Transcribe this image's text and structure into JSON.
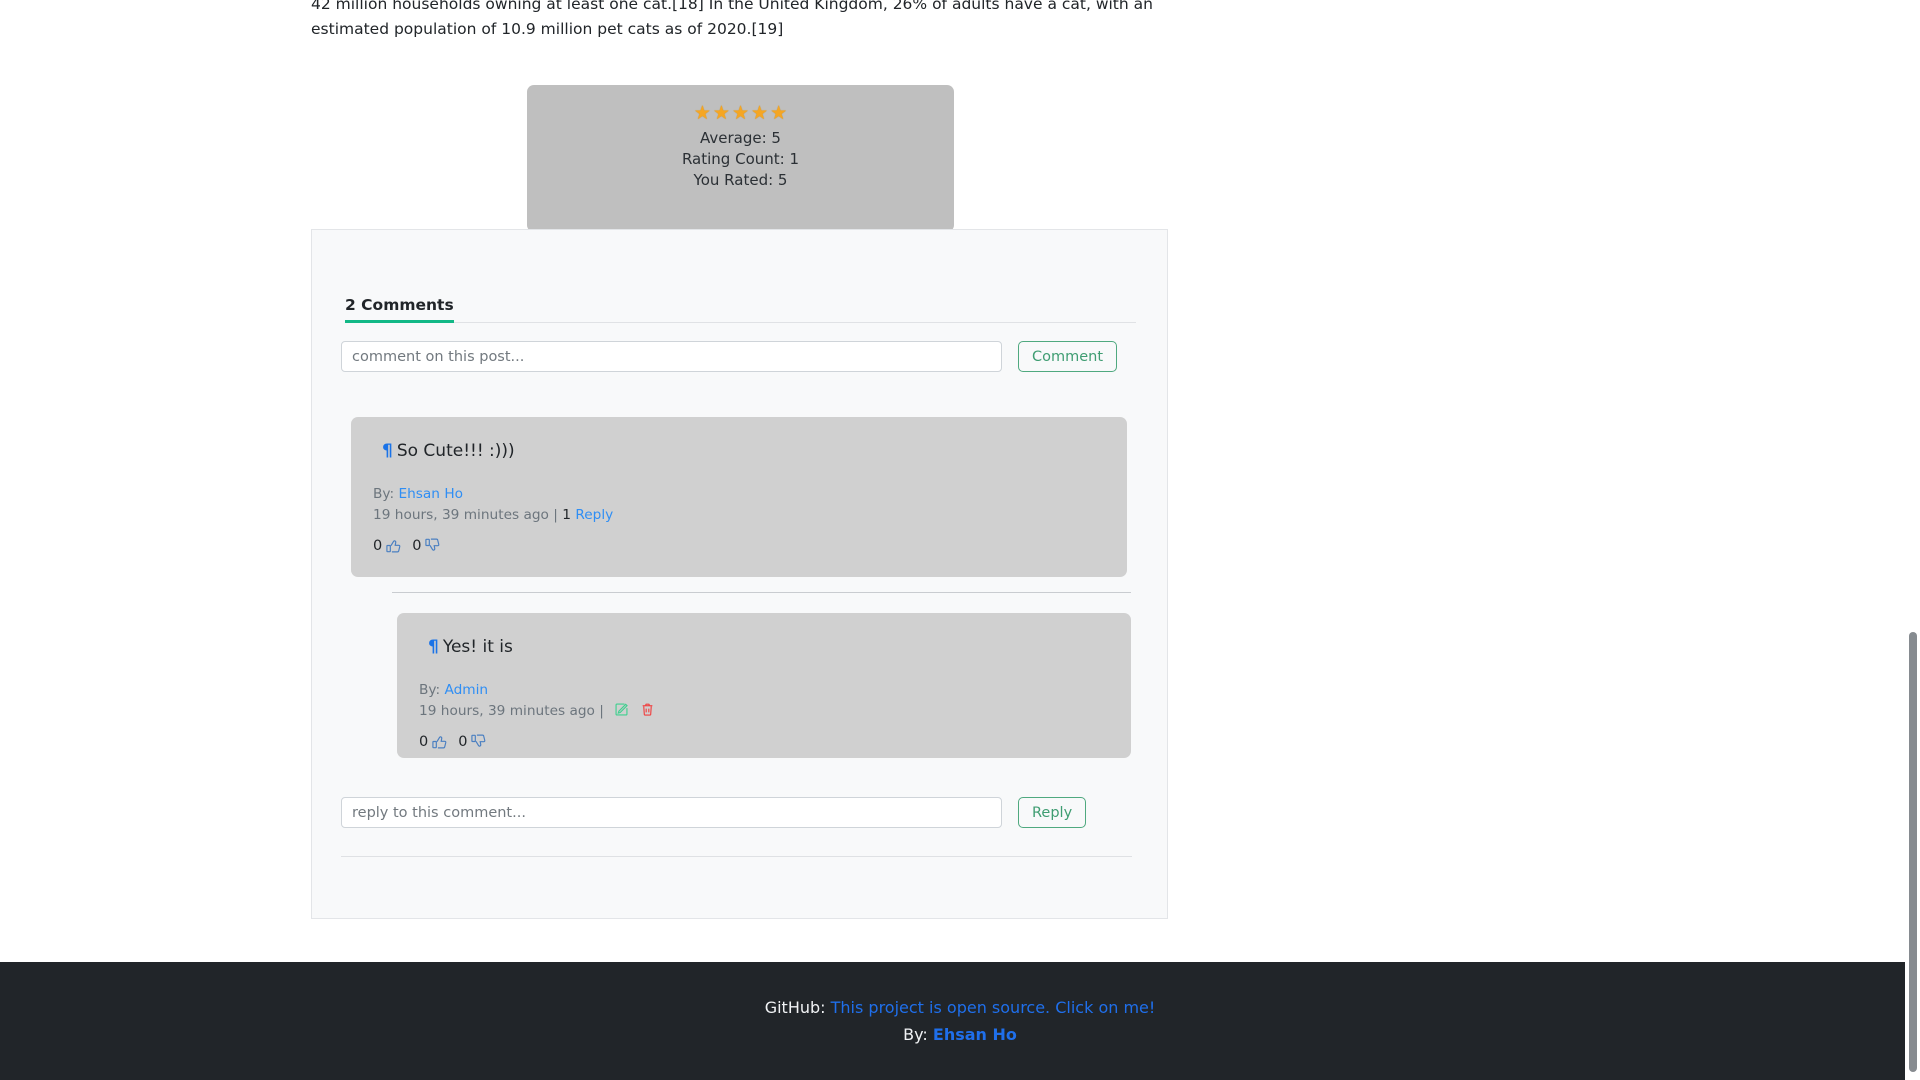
{
  "article": {
    "paragraph": "42 million households owning at least one cat.[18] In the United Kingdom, 26% of adults have a cat, with an estimated population of 10.9 million pet cats as of 2020.[19]"
  },
  "rating": {
    "stars_filled": 5,
    "star_glyph": "★",
    "average_label": "Average: 5",
    "count_label": "Rating Count: 1",
    "you_rated_label": "You Rated: 5",
    "star_color": "#f5a623",
    "box_color": "#bfbfbf"
  },
  "comments_section": {
    "header": "2 Comments",
    "accent_color": "#12b886",
    "new_comment": {
      "placeholder": "comment on this post...",
      "value": "",
      "button_label": "Comment"
    },
    "reply_form": {
      "placeholder": "reply to this comment...",
      "value": "",
      "button_label": "Reply"
    },
    "comments": [
      {
        "pilcrow": "¶",
        "body": "So Cute!!! :)))",
        "by_label": "By:",
        "author": "Ehsan Ho",
        "timestamp": "19 hours, 39 minutes ago",
        "separator": "|",
        "reply_count": "1",
        "reply_link": "Reply",
        "likes": "0",
        "dislikes": "0"
      },
      {
        "pilcrow": "¶",
        "body": "Yes! it is",
        "by_label": "By:",
        "author": "Admin",
        "timestamp": "19 hours, 39 minutes ago",
        "separator": "|",
        "edit_icon": "edit-icon",
        "delete_icon": "trash-icon",
        "likes": "0",
        "dislikes": "0"
      }
    ]
  },
  "footer": {
    "github_label": "GitHub:",
    "github_link": "This project is open source. Click on me!",
    "by_label": "By:",
    "by_author": "Ehsan Ho",
    "background": "#212529",
    "link_color": "#1f6feb"
  }
}
